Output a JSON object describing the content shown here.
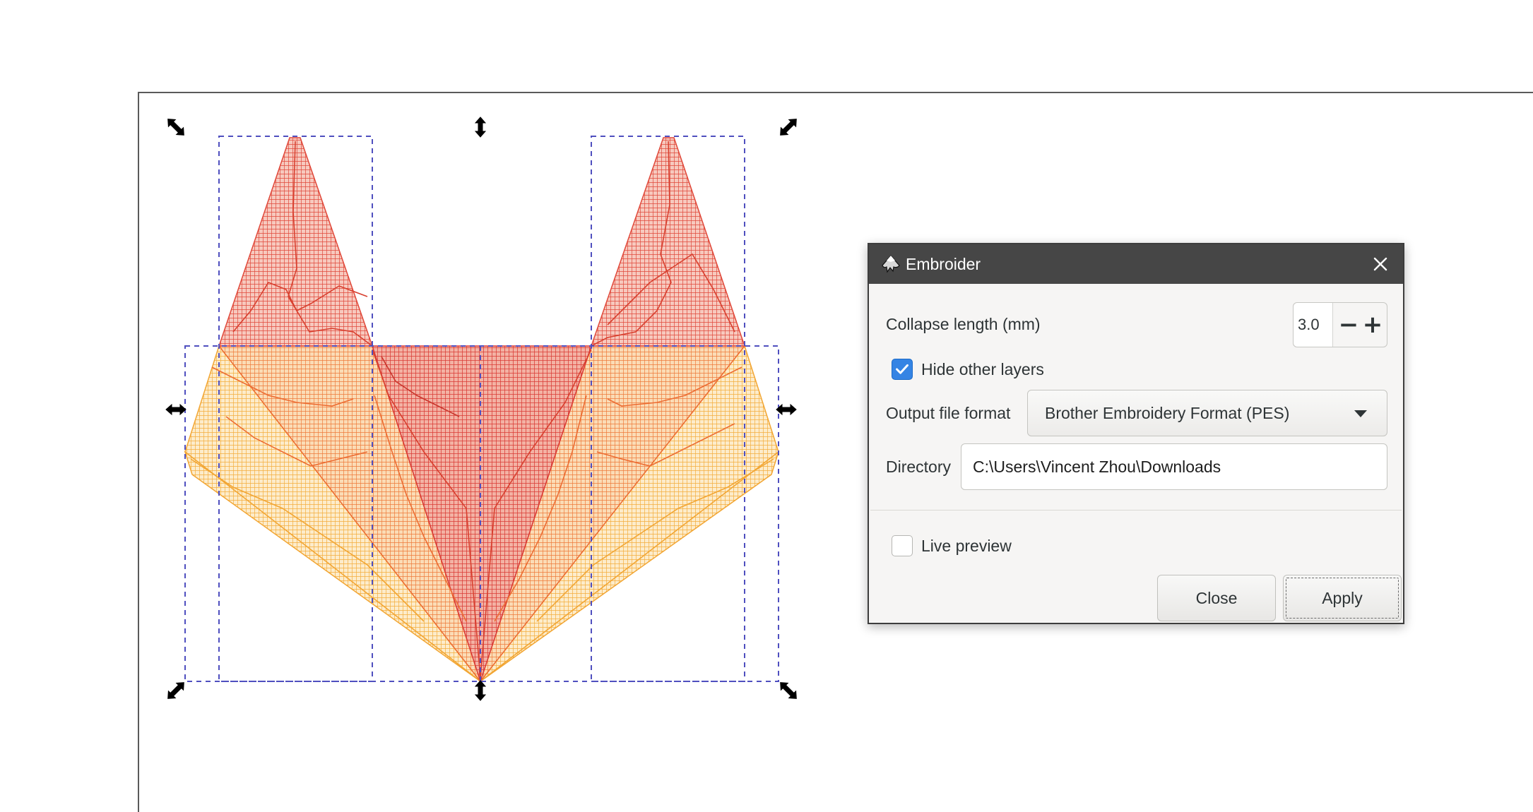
{
  "dialog": {
    "title": "Embroider",
    "app_icon": "inkscape-logo-icon",
    "close_icon": "close-icon",
    "collapse_length": {
      "label": "Collapse length (mm)",
      "value": "3.0",
      "minus": "−",
      "plus": "+"
    },
    "hide_other_layers": {
      "label": "Hide other layers",
      "checked": true
    },
    "output_format": {
      "label": "Output file format",
      "selected": "Brother Embroidery Format (PES)"
    },
    "directory": {
      "label": "Directory",
      "value": "C:\\Users\\Vincent Zhou\\Downloads"
    },
    "live_preview": {
      "label": "Live preview",
      "checked": false
    },
    "buttons": {
      "close": "Close",
      "apply": "Apply"
    }
  },
  "artwork": {
    "description_icon": "embroidery-fox-artwork",
    "colors": {
      "red": "#e0483a",
      "orange": "#f07a2a",
      "yellow": "#f6b13a",
      "guide": "#4f4fbf",
      "handle": "#000000"
    }
  }
}
